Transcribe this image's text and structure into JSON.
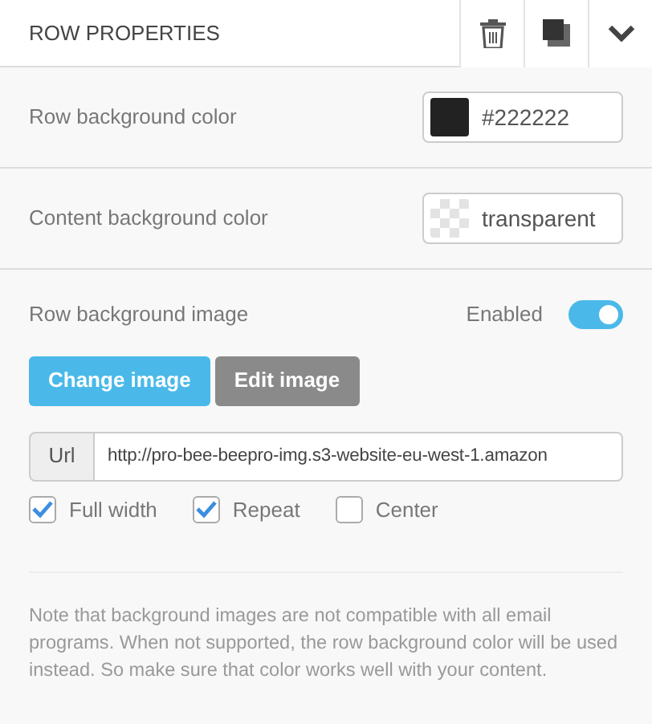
{
  "header": {
    "title": "ROW PROPERTIES"
  },
  "color_rows": [
    {
      "label": "Row background color",
      "value": "#222222",
      "kind": "solid",
      "color": "#222222"
    },
    {
      "label": "Content background color",
      "value": "transparent",
      "kind": "transparent"
    }
  ],
  "image_section": {
    "label": "Row background image",
    "toggle_label": "Enabled",
    "on": true,
    "buttons": [
      {
        "label": "Change image",
        "kind": "primary"
      },
      {
        "label": "Edit image",
        "kind": "secondary"
      }
    ],
    "url_addon": "Url",
    "url_value": "http://pro-bee-beepro-img.s3-website-eu-west-1.amazon",
    "options": [
      {
        "label": "Full width",
        "checked": true
      },
      {
        "label": "Repeat",
        "checked": true
      },
      {
        "label": "Center",
        "checked": false
      }
    ],
    "note": "Note that background images are not compatible with all email programs. When not supported, the row background color will be used instead. So make sure that color works well with your content."
  }
}
